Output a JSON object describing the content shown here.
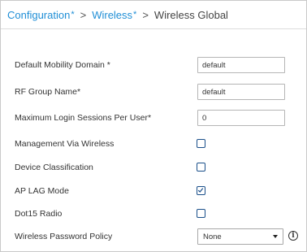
{
  "breadcrumb": {
    "items": [
      {
        "label": "Configuration",
        "modified_marker": "*"
      },
      {
        "label": "Wireless",
        "modified_marker": "*"
      }
    ],
    "separator": ">",
    "current": "Wireless Global"
  },
  "form": {
    "default_mobility_domain": {
      "label": "Default Mobility Domain *",
      "value": "default"
    },
    "rf_group_name": {
      "label": "RF Group Name*",
      "value": "default"
    },
    "max_login_sessions": {
      "label": "Maximum Login Sessions Per User*",
      "value": "0"
    },
    "management_via_wireless": {
      "label": "Management Via Wireless",
      "checked": false
    },
    "device_classification": {
      "label": "Device Classification",
      "checked": false
    },
    "ap_lag_mode": {
      "label": "AP LAG Mode",
      "checked": true
    },
    "dot15_radio": {
      "label": "Dot15 Radio",
      "checked": false
    },
    "wireless_password_policy": {
      "label": "Wireless Password Policy",
      "value": "None",
      "info_icon": "info-icon"
    }
  },
  "colors": {
    "link": "#1f8ed6",
    "checkbox_border": "#1a4f8a",
    "text": "#333333"
  }
}
